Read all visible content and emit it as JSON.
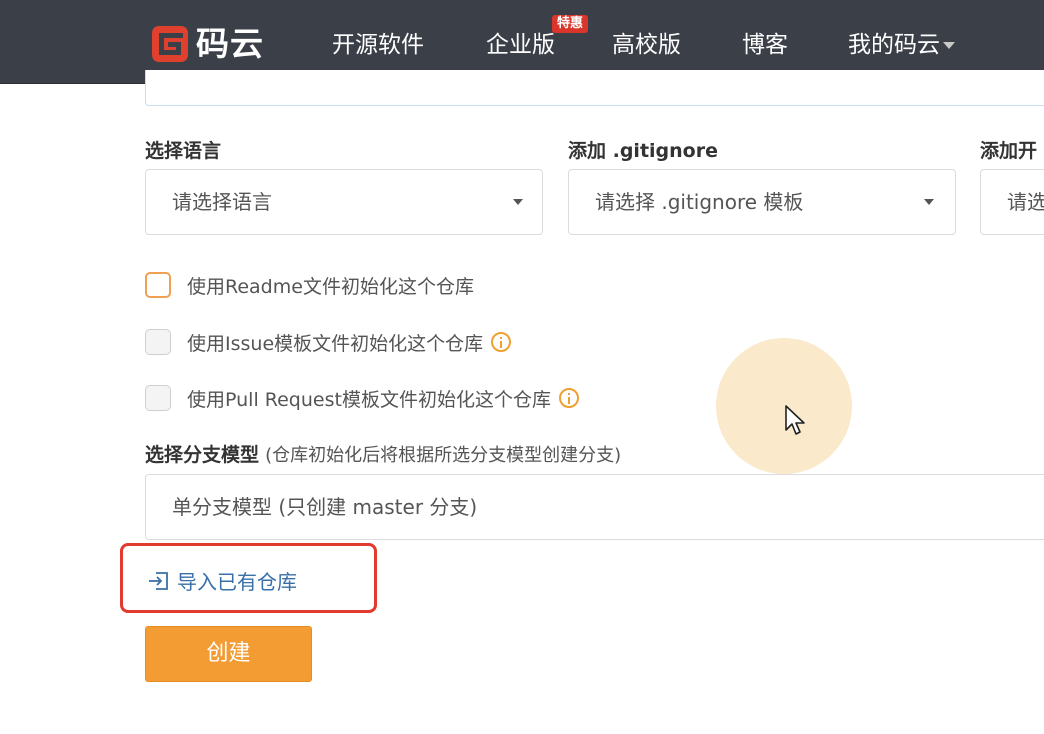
{
  "nav": {
    "logo_text": "码云",
    "items": [
      "开源软件",
      "企业版",
      "高校版",
      "博客",
      "我的码云"
    ],
    "badge": "特惠"
  },
  "form": {
    "language": {
      "label": "选择语言",
      "placeholder": "请选择语言"
    },
    "gitignore": {
      "label": "添加 .gitignore",
      "placeholder": "请选择 .gitignore 模板"
    },
    "license": {
      "label": "添加开",
      "placeholder": "请选"
    },
    "checkboxes": [
      "使用Readme文件初始化这个仓库",
      "使用Issue模板文件初始化这个仓库",
      "使用Pull Request模板文件初始化这个仓库"
    ],
    "branch": {
      "label": "选择分支模型",
      "hint": "(仓库初始化后将根据所选分支模型创建分支)",
      "value": "单分支模型 (只创建 master 分支)"
    },
    "import_link": "导入已有仓库",
    "create_button": "创建"
  },
  "colors": {
    "nav_bg": "#3b3f48",
    "accent_orange": "#f39c34",
    "logo_red": "#e0412f",
    "highlight_red": "#e23a2f",
    "link_blue": "#3a6fa8"
  },
  "icons": {
    "logo": "gitee-logo-icon",
    "info": "info-icon",
    "import": "import-icon",
    "cursor": "mouse-pointer-icon"
  }
}
